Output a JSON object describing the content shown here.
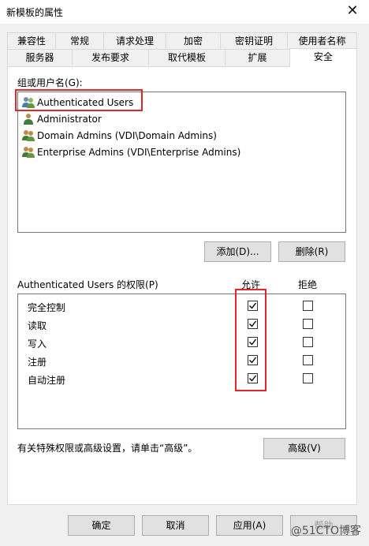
{
  "window": {
    "title": "新模板的属性",
    "close": "✕"
  },
  "tabs_row1": [
    "兼容性",
    "常规",
    "请求处理",
    "加密",
    "密钥证明",
    "使用者名称"
  ],
  "tabs_row2": [
    "服务器",
    "发布要求",
    "取代模板",
    "扩展",
    "安全"
  ],
  "group_label": "组或用户名(G):",
  "users": [
    "Authenticated Users",
    "Administrator",
    "Domain Admins (VDI\\Domain Admins)",
    "Enterprise Admins (VDI\\Enterprise Admins)"
  ],
  "buttons": {
    "add": "添加(D)...",
    "remove": "删除(R)",
    "advanced": "高级(V)",
    "ok": "确定",
    "cancel": "取消",
    "apply": "应用(A)",
    "help": "帮助"
  },
  "permissions_label": "Authenticated Users 的权限(P)",
  "col_allow": "允许",
  "col_deny": "拒绝",
  "permissions": [
    {
      "name": "完全控制",
      "allow": true,
      "deny": false
    },
    {
      "name": "读取",
      "allow": true,
      "deny": false
    },
    {
      "name": "写入",
      "allow": true,
      "deny": false
    },
    {
      "name": "注册",
      "allow": true,
      "deny": false
    },
    {
      "name": "自动注册",
      "allow": true,
      "deny": false
    }
  ],
  "advanced_hint": "有关特殊权限或高级设置，请单击“高级”。",
  "watermark": "@51CTO博客",
  "colors": {
    "highlight": "#e0282a",
    "panel_bg": "#f0f0f0"
  }
}
